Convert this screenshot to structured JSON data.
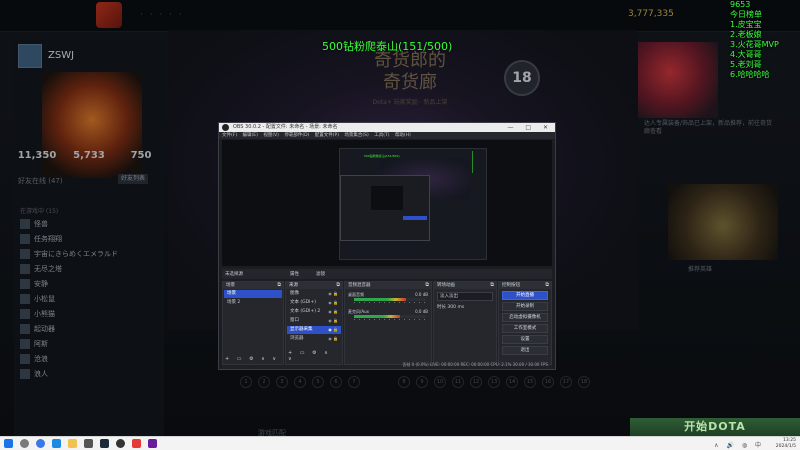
{
  "dota": {
    "top_nav": "· ·  ·  ·  ·",
    "gold": "3,777,335",
    "profile_name": "ZSWJ",
    "stats": [
      "11,350",
      "5,733",
      "750"
    ],
    "friends_header": "好友在线 (47)",
    "friends_button": "好友列表",
    "friends_group": "在游戏中 (15)",
    "friends": [
      "怪兽",
      "任务翔翔",
      "宇宙にきらめくエメラルド",
      "无尽之塔",
      "安静",
      "小松鼠",
      "小熊猫",
      "起动器",
      "阿斯",
      "沧浪",
      "浪人"
    ],
    "shop_title_line1": "奇货郎的",
    "shop_title_line2": "奇货廊",
    "shop_subtitle": "Dota+ 玩家奖励 · 新品上架",
    "level_badge": "18",
    "right_caption": "达人专属装备/饰品已上架，新品推荐，前往奇货廊查看",
    "right_caption2": "推荐英雄",
    "play_button": "开始DOTA",
    "bottom_label": "游戏匹配",
    "bottom_dots_left": [
      "1",
      "2",
      "3",
      "4",
      "5",
      "6",
      "7"
    ],
    "bottom_dots_right": [
      "8",
      "9",
      "10",
      "11",
      "12",
      "13",
      "14",
      "15",
      "16",
      "17",
      "18"
    ]
  },
  "overlay": {
    "goal_text": "500钻粉爬泰山(151/500)",
    "today_lines": [
      "9653",
      "今日榜单",
      "1.皮宝宝",
      "2.老板娘",
      "3.火花哥MVP",
      "4.大哥哥",
      "5.老刘哥",
      "6.哈哈哈哈"
    ]
  },
  "obs": {
    "title": "OBS 30.0.2 - 配置文件: 未命名 - 场景: 未命名",
    "window_controls": "— □ ✕",
    "menu": "文件(F) 编辑(E) 视图(V) 停靠部件(D) 配置文件(P) 场景集合(S) 工具(T) 帮助(H)",
    "preview_goal": "500钻粉爬泰山(151/500)",
    "controls_row": {
      "source_label": "未选择源",
      "props": "属性",
      "filters": "滤镜"
    },
    "docks": {
      "scenes": {
        "title": "场景",
        "items": [
          "场景",
          "场景 2"
        ],
        "selected_index": 0
      },
      "sources": {
        "title": "来源",
        "items": [
          "图像",
          "文本 (GDI+)",
          "文本 (GDI+) 2",
          "窗口",
          "显示器采集",
          "浏览器"
        ],
        "selected_index": 4
      },
      "mixer": {
        "title": "音频混音器",
        "tracks": [
          {
            "name": "桌面音频",
            "db": "0.0 dB",
            "level": 0.72
          },
          {
            "name": "麦克风/Aux",
            "db": "0.0 dB",
            "level": 0.64
          }
        ]
      },
      "transitions": {
        "title": "转场动画",
        "selected": "淡入淡出",
        "duration": "时长 300 ms"
      },
      "controls": {
        "title": "控制按钮",
        "buttons": [
          "开始直播",
          "开始录制",
          "启动虚拟摄像机",
          "工作室模式",
          "设置",
          "退出"
        ]
      }
    },
    "status": "丢帧 0 (0.0%)   LIVE: 00:00:00   REC: 00:00:00   CPU: 2.1%  30.00 / 30.00 FPS",
    "dock_footer": "+ ▭ ⚙ ∧ ∨"
  },
  "taskbar": {
    "time": "13:25",
    "date": "2024/1/5",
    "tray_icons": "∧ 🔊 ◍ 中"
  },
  "colors": {
    "obs_accent": "#2f51c7",
    "overlay_green": "#39ff39",
    "dota_play": "#2f5d35"
  }
}
